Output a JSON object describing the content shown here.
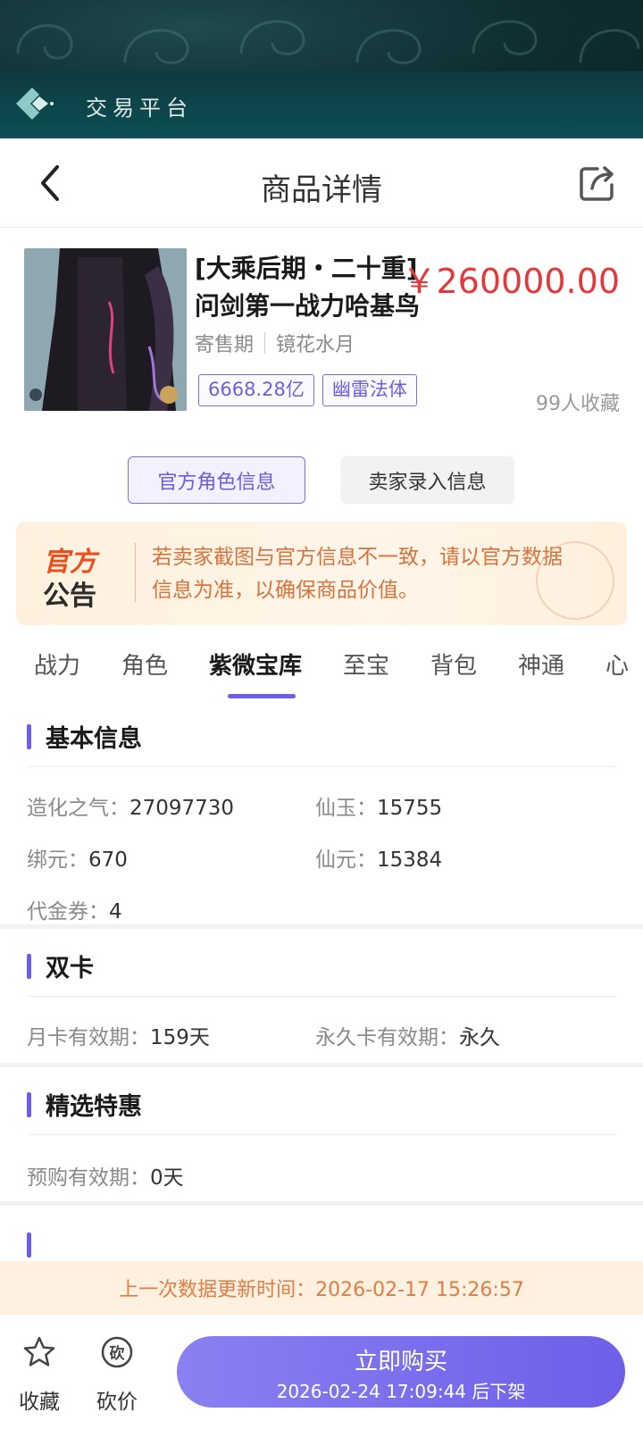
{
  "banner": {
    "title": "交易平台"
  },
  "header": {
    "title": "商品详情"
  },
  "product": {
    "title": "[大乘后期・二十重]问剑第一战力哈基鸟",
    "price": "￥260000.00",
    "status": "寄售期",
    "server": "镜花水月",
    "tags": [
      "6668.28亿",
      "幽雷法体"
    ],
    "favorites": "99人收藏"
  },
  "info_switch": {
    "official": "官方角色信息",
    "seller": "卖家录入信息"
  },
  "notice": {
    "badge_top": "官方",
    "badge_bottom": "公告",
    "text": "若卖家截图与官方信息不一致，请以官方数据信息为准，以确保商品价值。"
  },
  "tabs": [
    "战力",
    "角色",
    "紫微宝库",
    "至宝",
    "背包",
    "神通",
    "心"
  ],
  "active_tab": "紫微宝库",
  "sections": {
    "basic": {
      "title": "基本信息",
      "rows": [
        {
          "label": "造化之气：",
          "value": "27097730"
        },
        {
          "label": "仙玉：",
          "value": "15755"
        },
        {
          "label": "绑元：",
          "value": "670"
        },
        {
          "label": "仙元：",
          "value": "15384"
        },
        {
          "label": "代金券：",
          "value": "4"
        }
      ]
    },
    "dual_card": {
      "title": "双卡",
      "rows": [
        {
          "label": "月卡有效期：",
          "value": "159天"
        },
        {
          "label": "永久卡有效期：",
          "value": "永久"
        }
      ]
    },
    "featured": {
      "title": "精选特惠",
      "rows": [
        {
          "label": "预购有效期：",
          "value": "0天"
        }
      ]
    }
  },
  "update_bar": {
    "text": "上一次数据更新时间：2026-02-17 15:26:57"
  },
  "bottom": {
    "favorite_label": "收藏",
    "bargain_label": "砍价",
    "bargain_icon_char": "砍",
    "buy_label": "立即购买",
    "buy_sub": "2026-02-24 17:09:44 后下架"
  },
  "colors": {
    "accent": "#6c5fe6",
    "price": "#e4393c",
    "notice_text": "#d6733c"
  },
  "icons": [
    "back-icon",
    "share-icon",
    "star-icon",
    "bargain-icon",
    "logo-icon"
  ]
}
